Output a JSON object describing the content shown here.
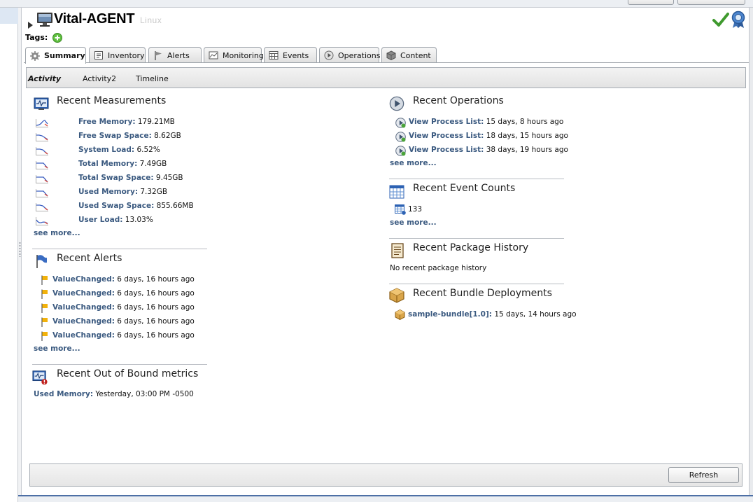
{
  "header": {
    "resource_name": "Vital-AGENT",
    "resource_type": "Linux",
    "tags_label": "Tags:"
  },
  "tabs": [
    {
      "label": "Summary",
      "icon": "gear-icon",
      "active": true
    },
    {
      "label": "Inventory",
      "icon": "inventory-icon",
      "active": false
    },
    {
      "label": "Alerts",
      "icon": "flag-icon",
      "active": false
    },
    {
      "label": "Monitoring",
      "icon": "monitoring-icon",
      "active": false
    },
    {
      "label": "Events",
      "icon": "events-icon",
      "active": false
    },
    {
      "label": "Operations",
      "icon": "play-icon",
      "active": false
    },
    {
      "label": "Content",
      "icon": "package-icon",
      "active": false
    }
  ],
  "subtabs": [
    {
      "label": "Activity",
      "active": true
    },
    {
      "label": "Activity2",
      "active": false
    },
    {
      "label": "Timeline",
      "active": false
    }
  ],
  "measurements": {
    "title": "Recent Measurements",
    "items": [
      {
        "label": "Free Memory:",
        "value": "179.21MB"
      },
      {
        "label": "Free Swap Space:",
        "value": "8.62GB"
      },
      {
        "label": "System Load:",
        "value": "6.52%"
      },
      {
        "label": "Total Memory:",
        "value": "7.49GB"
      },
      {
        "label": "Total Swap Space:",
        "value": "9.45GB"
      },
      {
        "label": "Used Memory:",
        "value": "7.32GB"
      },
      {
        "label": "Used Swap Space:",
        "value": "855.66MB"
      },
      {
        "label": "User Load:",
        "value": "13.03%"
      }
    ],
    "see_more": "see more..."
  },
  "alerts": {
    "title": "Recent Alerts",
    "items": [
      {
        "label": "ValueChanged:",
        "value": "6 days, 16 hours ago"
      },
      {
        "label": "ValueChanged:",
        "value": "6 days, 16 hours ago"
      },
      {
        "label": "ValueChanged:",
        "value": "6 days, 16 hours ago"
      },
      {
        "label": "ValueChanged:",
        "value": "6 days, 16 hours ago"
      },
      {
        "label": "ValueChanged:",
        "value": "6 days, 16 hours ago"
      }
    ],
    "see_more": "see more..."
  },
  "oob": {
    "title": "Recent Out of Bound metrics",
    "items": [
      {
        "label": "Used Memory:",
        "value": "Yesterday, 03:00 PM -0500"
      }
    ]
  },
  "operations": {
    "title": "Recent Operations",
    "items": [
      {
        "label": "View Process List:",
        "value": "15 days, 8 hours ago"
      },
      {
        "label": "View Process List:",
        "value": "18 days, 15 hours ago"
      },
      {
        "label": "View Process List:",
        "value": "38 days, 19 hours ago"
      }
    ],
    "see_more": "see more..."
  },
  "events": {
    "title": "Recent Event Counts",
    "count": "133",
    "see_more": "see more..."
  },
  "packages": {
    "title": "Recent Package History",
    "empty_text": "No recent package history"
  },
  "bundles": {
    "title": "Recent Bundle Deployments",
    "items": [
      {
        "label": "sample-bundle[1.0]:",
        "value": "15 days, 14 hours ago"
      }
    ]
  },
  "footer": {
    "refresh_label": "Refresh"
  },
  "colors": {
    "link": "#3b5a80",
    "border": "#9ea4ab",
    "accent": "#4d6fa5"
  }
}
